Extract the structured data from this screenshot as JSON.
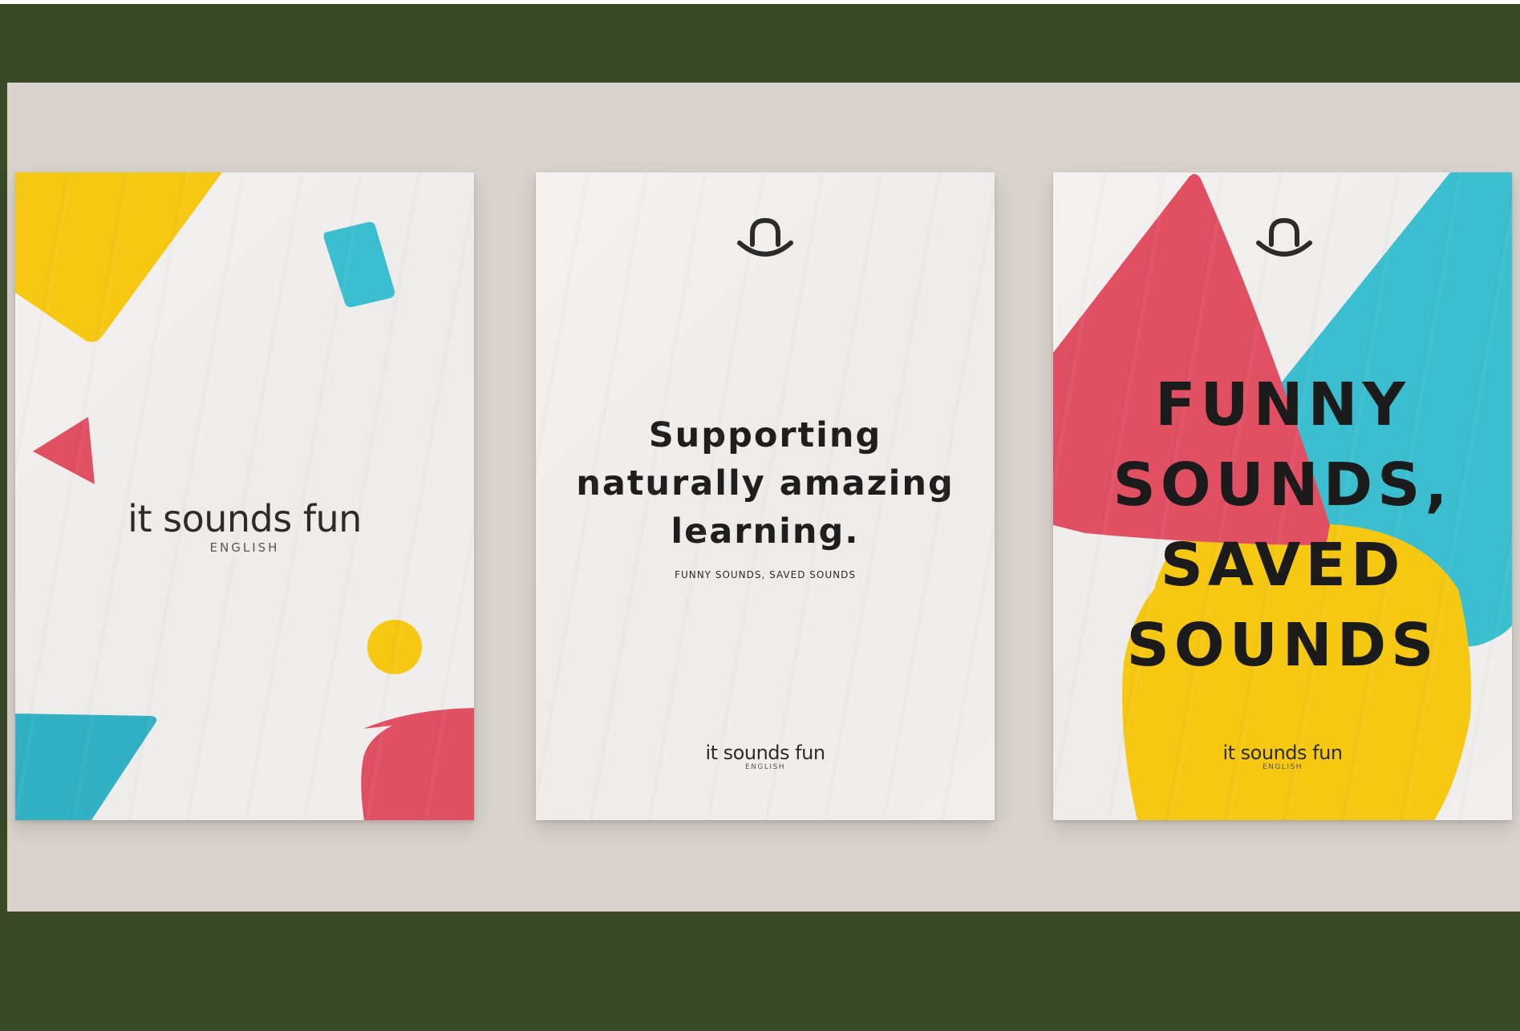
{
  "colors": {
    "frame": "#3a4a27",
    "wall": "#d9d3ce",
    "paper": "#f2f0ef",
    "yellow": "#f6c812",
    "cyan": "#3bbfd0",
    "red": "#e14f63",
    "ink": "#1e1e1e"
  },
  "posters": [
    {
      "logo": {
        "wordmark": "it sounds fun",
        "sub": "ENGLISH"
      }
    },
    {
      "icon": "hat-smile-icon",
      "headline_lines": [
        "Supporting",
        "naturally amazing",
        "learning."
      ],
      "tagline": "FUNNY SOUNDS, SAVED SOUNDS",
      "logo": {
        "wordmark": "it sounds fun",
        "sub": "ENGLISH"
      }
    },
    {
      "icon": "hat-smile-icon",
      "headline_lines": [
        "FUNNY",
        "SOUNDS,",
        "SAVED",
        "SOUNDS"
      ],
      "logo": {
        "wordmark": "it sounds fun",
        "sub": "ENGLISH"
      }
    }
  ]
}
